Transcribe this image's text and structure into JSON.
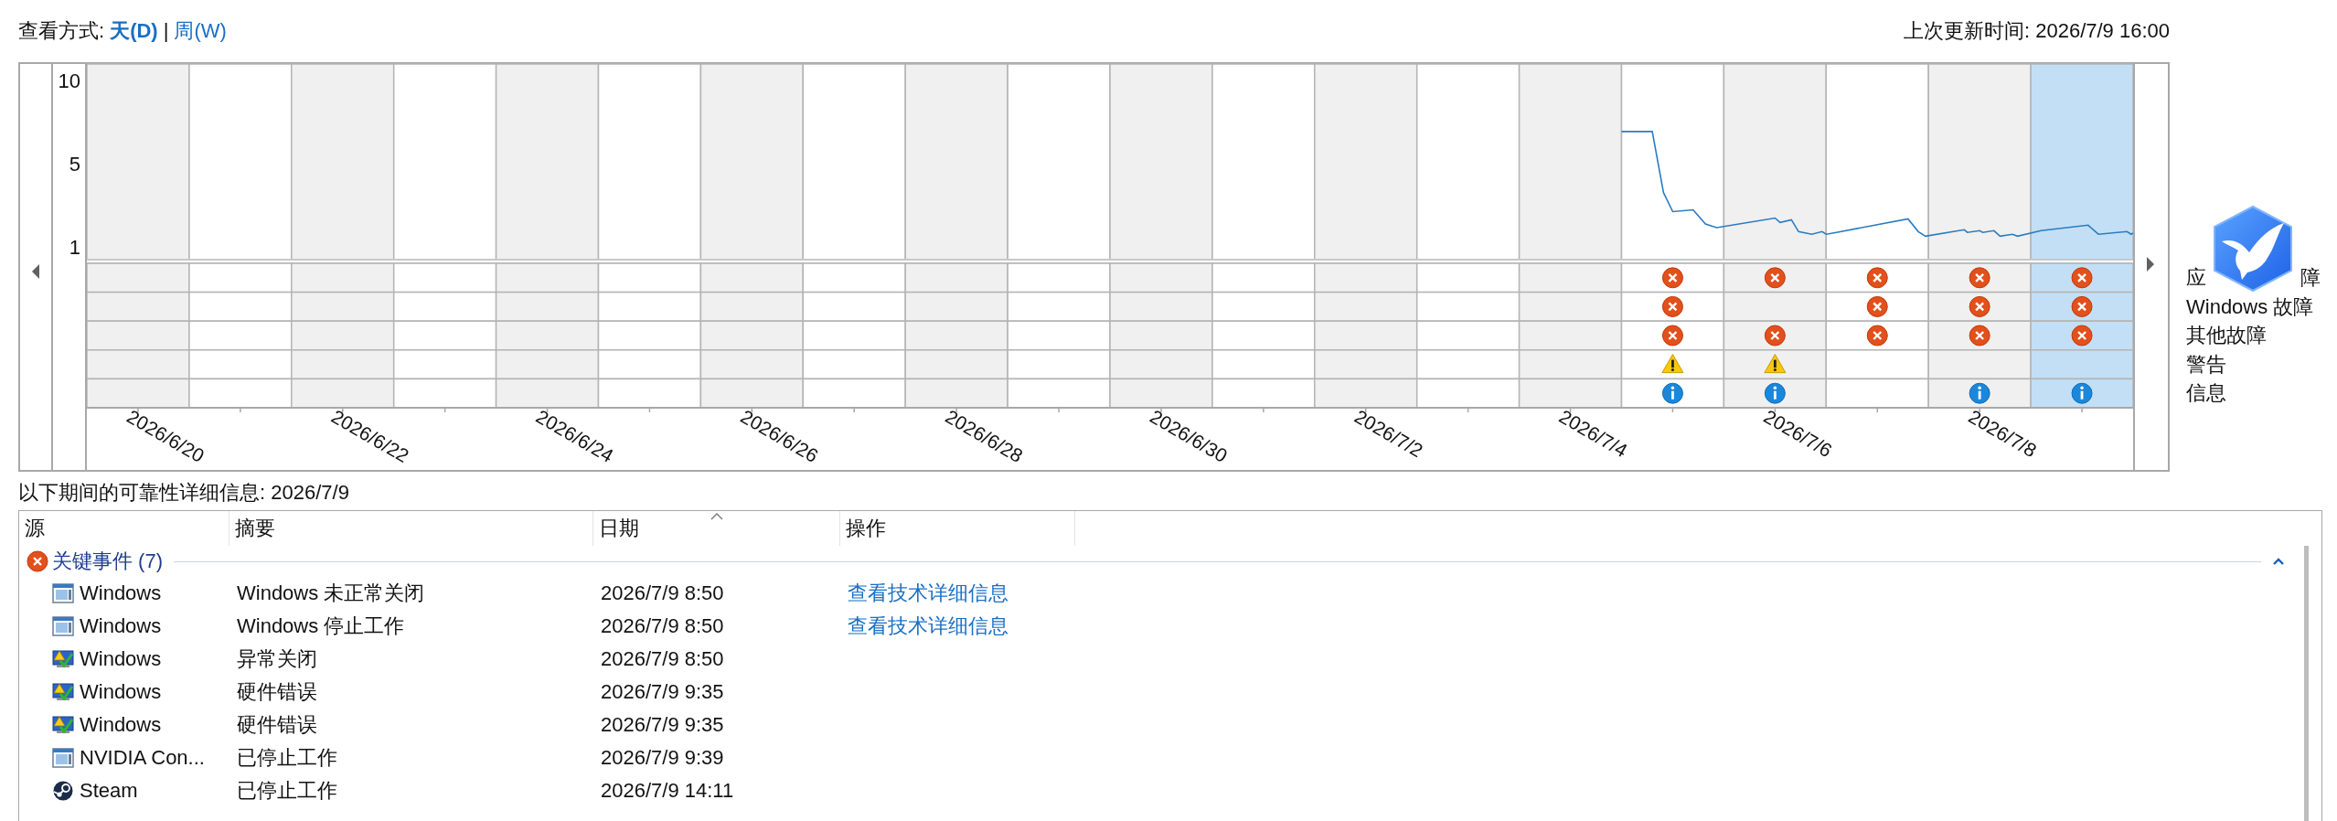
{
  "view": {
    "label": "查看方式:",
    "separator": "|",
    "modes": [
      {
        "label": "天(D)",
        "selected": true
      },
      {
        "label": "周(W)",
        "selected": false
      }
    ]
  },
  "last_updated": "上次更新时间: 2026/7/9 16:00",
  "columns": [
    {
      "selected": false
    },
    {
      "selected": false
    },
    {
      "selected": false
    },
    {
      "selected": false
    },
    {
      "selected": false
    },
    {
      "selected": false
    },
    {
      "selected": false
    },
    {
      "selected": false
    },
    {
      "selected": false
    },
    {
      "selected": false
    },
    {
      "selected": false
    },
    {
      "selected": false
    },
    {
      "selected": false
    },
    {
      "selected": false
    },
    {
      "selected": false
    },
    {
      "selected": false
    },
    {
      "selected": false
    },
    {
      "selected": false
    },
    {
      "selected": false
    },
    {
      "selected": true
    }
  ],
  "event_rows": [
    {
      "parts": [
        "应",
        "障"
      ],
      "kind": "error",
      "marked": [
        false,
        false,
        false,
        false,
        false,
        false,
        false,
        false,
        false,
        false,
        false,
        false,
        false,
        false,
        false,
        true,
        true,
        true,
        true,
        true
      ]
    },
    {
      "parts": [
        "Windows 故障"
      ],
      "kind": "error",
      "marked": [
        false,
        false,
        false,
        false,
        false,
        false,
        false,
        false,
        false,
        false,
        false,
        false,
        false,
        false,
        false,
        true,
        false,
        true,
        true,
        true
      ]
    },
    {
      "parts": [
        "其他故障"
      ],
      "kind": "error",
      "marked": [
        false,
        false,
        false,
        false,
        false,
        false,
        false,
        false,
        false,
        false,
        false,
        false,
        false,
        false,
        false,
        true,
        true,
        true,
        true,
        true
      ]
    },
    {
      "parts": [
        "警告"
      ],
      "kind": "warning",
      "marked": [
        false,
        false,
        false,
        false,
        false,
        false,
        false,
        false,
        false,
        false,
        false,
        false,
        false,
        false,
        false,
        true,
        true,
        false,
        false,
        false
      ]
    },
    {
      "parts": [
        "信息"
      ],
      "kind": "info",
      "marked": [
        false,
        false,
        false,
        false,
        false,
        false,
        false,
        false,
        false,
        false,
        false,
        false,
        false,
        false,
        false,
        true,
        true,
        false,
        true,
        true
      ]
    }
  ],
  "y_axis_labels": [
    "10",
    "5",
    "1"
  ],
  "date_labels": [
    "2026/6/20",
    "2026/6/22",
    "2026/6/24",
    "2026/6/26",
    "2026/6/28",
    "2026/6/30",
    "2026/7/2",
    "2026/7/4",
    "2026/7/6",
    "2026/7/8"
  ],
  "details_title": "以下期间的可靠性详细信息: 2026/7/9",
  "table": {
    "columns": [
      {
        "label": "源",
        "sorted": false
      },
      {
        "label": "摘要",
        "sorted": false
      },
      {
        "label": "日期",
        "sorted": true
      },
      {
        "label": "操作",
        "sorted": false
      }
    ],
    "groups": [
      {
        "label": "关键事件 (7)",
        "kind": "error",
        "expanded": true,
        "rows": [
          {
            "kind": "window",
            "source": "Windows",
            "summary": "Windows 未正常关闭",
            "date": "2026/7/9 8:50",
            "action": "查看技术详细信息"
          },
          {
            "kind": "window",
            "source": "Windows",
            "summary": "Windows 停止工作",
            "date": "2026/7/9 8:50",
            "action": "查看技术详细信息"
          },
          {
            "kind": "monitor",
            "source": "Windows",
            "summary": "异常关闭",
            "date": "2026/7/9 8:50"
          },
          {
            "kind": "monitor",
            "source": "Windows",
            "summary": "硬件错误",
            "date": "2026/7/9 9:35"
          },
          {
            "kind": "monitor",
            "source": "Windows",
            "summary": "硬件错误",
            "date": "2026/7/9 9:35"
          },
          {
            "kind": "window",
            "source": "NVIDIA Con...",
            "summary": "已停止工作",
            "date": "2026/7/9 9:39"
          },
          {
            "kind": "steam",
            "source": "Steam",
            "summary": "已停止工作",
            "date": "2026/7/9 14:11"
          }
        ]
      }
    ]
  }
}
